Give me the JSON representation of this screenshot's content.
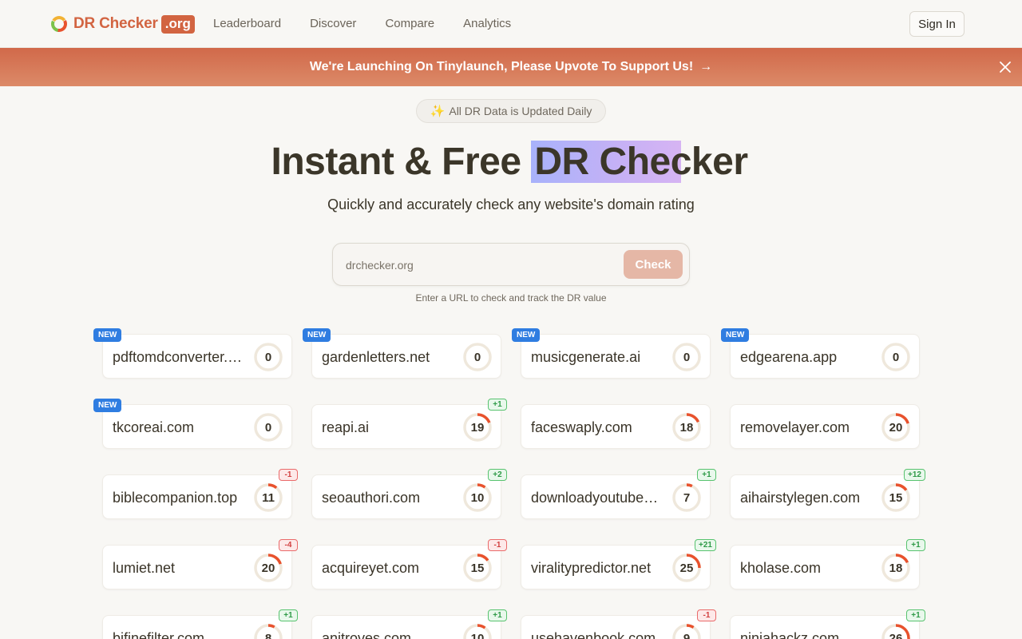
{
  "header": {
    "logo_text": "DR Checker",
    "logo_badge": ".org",
    "nav": [
      "Leaderboard",
      "Discover",
      "Compare",
      "Analytics"
    ],
    "sign_in": "Sign In"
  },
  "banner": {
    "text": "We're Launching On Tinylaunch, Please Upvote To Support Us!",
    "arrow": "→"
  },
  "pill": {
    "icon": "✨",
    "text": "All DR Data is Updated Daily"
  },
  "hero": {
    "title_prefix": "Instant & Free ",
    "title_highlight": "DR Checker",
    "subtitle": "Quickly and accurately check any website's domain rating"
  },
  "search": {
    "placeholder": "drchecker.org",
    "button": "Check",
    "hint": "Enter a URL to check and track the DR value"
  },
  "colors": {
    "brand": "#d26441",
    "ring_track": "#efe8dc",
    "ring_fill": "#e8522d",
    "new_badge": "#2f7de1"
  },
  "sites": [
    {
      "domain": "pdftomdconverter.com",
      "dr": 0,
      "new": true,
      "delta": ""
    },
    {
      "domain": "gardenletters.net",
      "dr": 0,
      "new": true,
      "delta": ""
    },
    {
      "domain": "musicgenerate.ai",
      "dr": 0,
      "new": true,
      "delta": ""
    },
    {
      "domain": "edgearena.app",
      "dr": 0,
      "new": true,
      "delta": ""
    },
    {
      "domain": "tkcoreai.com",
      "dr": 0,
      "new": true,
      "delta": ""
    },
    {
      "domain": "reapi.ai",
      "dr": 19,
      "new": false,
      "delta": "+1"
    },
    {
      "domain": "faceswaply.com",
      "dr": 18,
      "new": false,
      "delta": ""
    },
    {
      "domain": "removelayer.com",
      "dr": 20,
      "new": false,
      "delta": ""
    },
    {
      "domain": "biblecompanion.top",
      "dr": 11,
      "new": false,
      "delta": "-1"
    },
    {
      "domain": "seoauthori.com",
      "dr": 10,
      "new": false,
      "delta": "+2"
    },
    {
      "domain": "downloadyoutubevideo.com",
      "dr": 7,
      "new": false,
      "delta": "+1"
    },
    {
      "domain": "aihairstylegen.com",
      "dr": 15,
      "new": false,
      "delta": "+12"
    },
    {
      "domain": "lumiet.net",
      "dr": 20,
      "new": false,
      "delta": "-4"
    },
    {
      "domain": "acquireyet.com",
      "dr": 15,
      "new": false,
      "delta": "-1"
    },
    {
      "domain": "viralitypredictor.net",
      "dr": 25,
      "new": false,
      "delta": "+21"
    },
    {
      "domain": "kholase.com",
      "dr": 18,
      "new": false,
      "delta": "+1"
    },
    {
      "domain": "bifinefilter.com",
      "dr": 8,
      "new": false,
      "delta": "+1"
    },
    {
      "domain": "anitroves.com",
      "dr": 10,
      "new": false,
      "delta": "+1"
    },
    {
      "domain": "usehavenbook.com",
      "dr": 9,
      "new": false,
      "delta": "-1"
    },
    {
      "domain": "ninjahackz.com",
      "dr": 26,
      "new": false,
      "delta": "+1"
    }
  ]
}
